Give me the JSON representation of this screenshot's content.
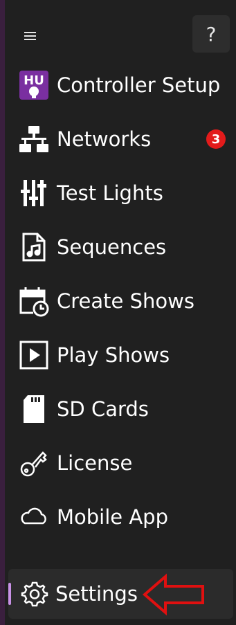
{
  "help": {
    "label": "?"
  },
  "nav": {
    "items": [
      {
        "label": "Controller Setup",
        "icon": "hu-logo-icon"
      },
      {
        "label": "Networks",
        "icon": "network-icon",
        "badge": "3"
      },
      {
        "label": "Test Lights",
        "icon": "sliders-icon"
      },
      {
        "label": "Sequences",
        "icon": "music-file-icon"
      },
      {
        "label": "Create Shows",
        "icon": "calendar-clock-icon"
      },
      {
        "label": "Play Shows",
        "icon": "play-icon"
      },
      {
        "label": "SD Cards",
        "icon": "sd-card-icon"
      },
      {
        "label": "License",
        "icon": "key-icon"
      },
      {
        "label": "Mobile App",
        "icon": "cloud-icon"
      }
    ]
  },
  "settings": {
    "label": "Settings",
    "icon": "gear-icon"
  },
  "annotation": {
    "arrow_color": "#e01010",
    "icon": "red-arrow-icon"
  },
  "colors": {
    "background": "#202020",
    "badge": "#e31b1b",
    "selection_indicator": "#c891e6",
    "hu_logo": "#7a2fa0"
  }
}
